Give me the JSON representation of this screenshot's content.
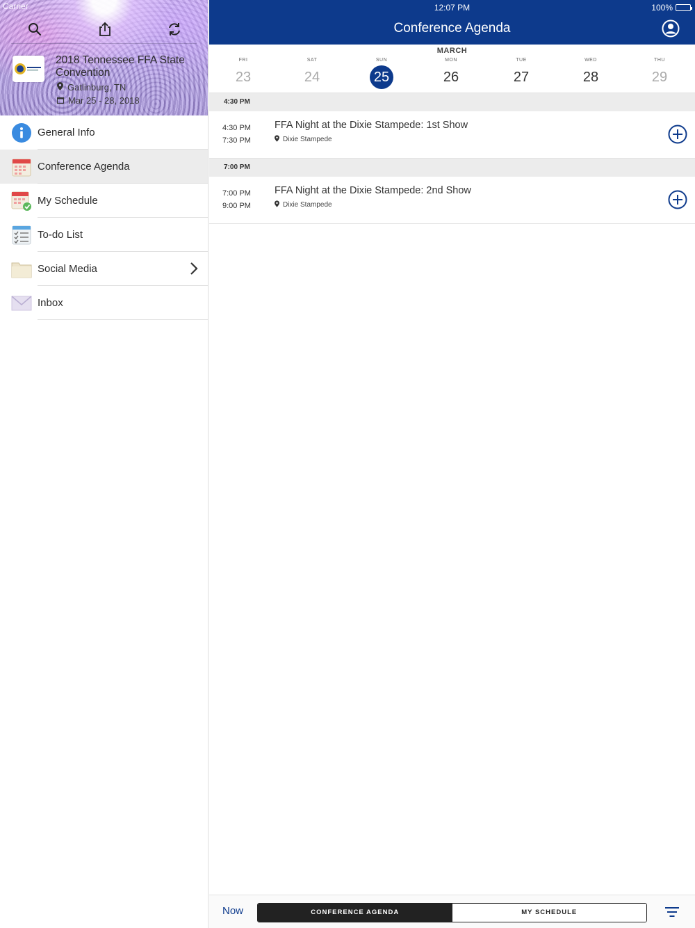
{
  "status": {
    "carrier": "Carrier",
    "time": "12:07 PM",
    "battery": "100%"
  },
  "sidebar": {
    "event": {
      "title": "2018 Tennessee FFA State Convention",
      "location": "Gatlinburg, TN",
      "dates": "Mar 25 - 28, 2018"
    },
    "items": [
      {
        "label": "General Info",
        "icon": "info-icon"
      },
      {
        "label": "Conference Agenda",
        "icon": "calendar-icon"
      },
      {
        "label": "My Schedule",
        "icon": "calendar-check-icon"
      },
      {
        "label": "To-do List",
        "icon": "checklist-icon"
      },
      {
        "label": "Social Media",
        "icon": "folder-icon"
      },
      {
        "label": "Inbox",
        "icon": "envelope-icon"
      }
    ]
  },
  "header": {
    "title": "Conference Agenda"
  },
  "calendar": {
    "month": "MARCH",
    "days": [
      {
        "dow": "FRI",
        "num": "23"
      },
      {
        "dow": "SAT",
        "num": "24"
      },
      {
        "dow": "SUN",
        "num": "25"
      },
      {
        "dow": "MON",
        "num": "26"
      },
      {
        "dow": "TUE",
        "num": "27"
      },
      {
        "dow": "WED",
        "num": "28"
      },
      {
        "dow": "THU",
        "num": "29"
      }
    ],
    "selected": "25"
  },
  "agenda": [
    {
      "header": "4:30 PM",
      "session": {
        "start": "4:30 PM",
        "end": "7:30 PM",
        "title": "FFA Night at the Dixie Stampede: 1st Show",
        "location": "Dixie Stampede"
      }
    },
    {
      "header": "7:00 PM",
      "session": {
        "start": "7:00 PM",
        "end": "9:00 PM",
        "title": "FFA Night at the Dixie Stampede: 2nd Show",
        "location": "Dixie Stampede"
      }
    }
  ],
  "bottom": {
    "now": "Now",
    "tab_agenda": "CONFERENCE AGENDA",
    "tab_schedule": "MY SCHEDULE"
  },
  "colors": {
    "brand": "#0d3a8c",
    "active_row": "#ececec"
  }
}
